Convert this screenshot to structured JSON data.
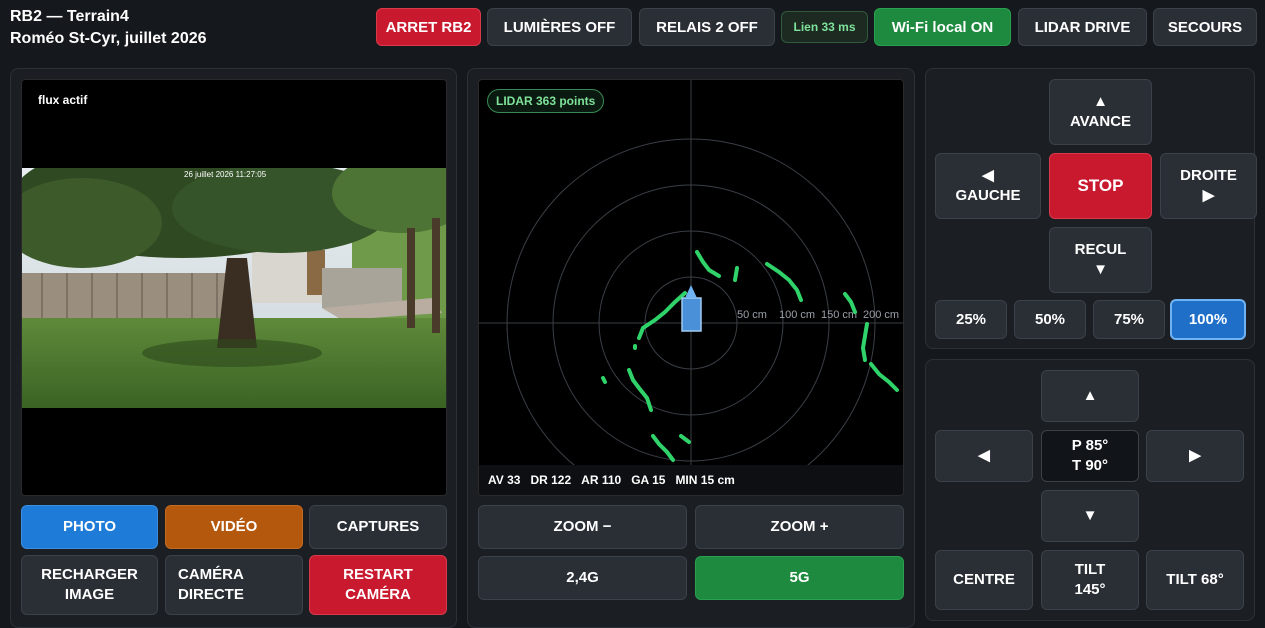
{
  "header": {
    "title_line1": "RB2 — Terrain4",
    "title_line2": "Roméo St-Cyr, juillet 2026"
  },
  "toolbar": {
    "arret": "ARRET RB2",
    "lumieres": "LUMIÈRES OFF",
    "relais": "RELAIS 2 OFF",
    "lien": "Lien 33 ms",
    "wifi": "Wi-Fi local ON",
    "lidar_drive": "LIDAR DRIVE",
    "secours": "SECOURS"
  },
  "camera": {
    "status": "flux actif",
    "timestamp": "26 juillet 2026 11:27:05",
    "buttons": {
      "photo": "PHOTO",
      "video": "VIDÉO",
      "captures": "CAPTURES",
      "recharger_l1": "RECHARGER",
      "recharger_l2": "IMAGE",
      "directe_l1": "CAMÉRA",
      "directe_l2": "DIRECTE",
      "restart_l1": "RESTART",
      "restart_l2": "CAMÉRA"
    }
  },
  "lidar": {
    "badge": "LIDAR 363 points",
    "ring_labels": [
      "50 cm",
      "100 cm",
      "150 cm",
      "200 cm"
    ],
    "footer": {
      "av": "AV 33",
      "dr": "DR 122",
      "ar": "AR 110",
      "ga": "GA 15",
      "min": "MIN 15 cm"
    },
    "buttons": {
      "zoom_out": "ZOOM −",
      "zoom_in": "ZOOM +",
      "band_24": "2,4G",
      "band_5": "5G"
    }
  },
  "drive": {
    "avance": "AVANCE",
    "gauche": "GAUCHE",
    "stop": "STOP",
    "droite": "DROITE",
    "recul": "RECUL",
    "speeds": [
      "25%",
      "50%",
      "75%",
      "100%"
    ],
    "active_speed": "100%"
  },
  "pantilt": {
    "pan": "P 85°",
    "tilt": "T 90°",
    "centre": "CENTRE",
    "tilt145_l1": "TILT",
    "tilt145_l2": "145°",
    "tilt68": "TILT 68°"
  },
  "colors": {
    "accent_red": "#c9192f",
    "accent_green": "#1e8a3f",
    "accent_blue": "#1f7bd8",
    "accent_orange": "#b3580d",
    "lidar_points": "#2fd36a"
  }
}
